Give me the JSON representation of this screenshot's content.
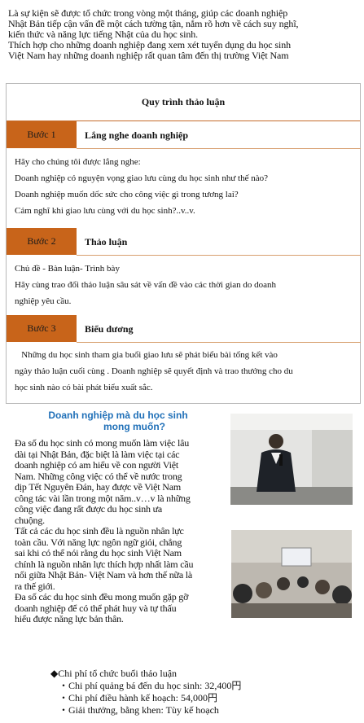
{
  "intro": {
    "lines": [
      "Là sự kiện sẽ được tổ chức trong vòng một tháng, giúp các doanh nghiệp",
      "Nhật Bản tiếp cận vấn đề một cách tường tận, nắm rõ hơn về cách suy nghĩ,",
      "kiến thức và năng lực tiếng Nhật của du học sinh.",
      "Thích hợp cho những doanh nghiệp đang xem xét tuyển dụng du học sinh",
      "Việt Nam hay những doanh nghiệp rất quan tâm đến thị trường Việt Nam"
    ]
  },
  "process": {
    "title": "Quy trình thảo luận",
    "steps": [
      {
        "label": "Bước 1",
        "title": "Lắng nghe doanh nghiệp",
        "lines": [
          "Hãy cho chúng tôi được lắng nghe:",
          "Doanh nghiệp có nguyện vọng giao lưu cùng du học sinh như thế nào?",
          "Doanh nghiệp muốn dốc sức cho công việc gì trong tương lai?",
          "Cảm nghĩ khi giao lưu cùng với du học sinh?..v..v."
        ]
      },
      {
        "label": "Bước 2",
        "title": "Thảo luận",
        "lines": [
          "Chủ đề - Bàn luận- Trình bày",
          "Hãy cùng trao đổi thảo luận sâu sát về vấn đề vào các thời gian do doanh",
          "nghiệp yêu cầu."
        ]
      },
      {
        "label": "Bước 3",
        "title": "Biểu dương",
        "lines": [
          "   Những du học sinh tham gia buổi giao lưu sẽ phát biểu bài tổng kết vào",
          "ngày thảo luận cuối cùng . Doanh nghiệp sẽ quyết định và trao thưởng cho du",
          "học sinh nào có bài phát biểu xuất sắc."
        ]
      }
    ]
  },
  "section2": {
    "heading_line1": "Doanh nghiệp mà du học sinh",
    "heading_line2": "mong muốn?",
    "lines": [
      "Đa số du học sinh có mong muốn làm việc lâu",
      "dài tại Nhật Bản, đặc biệt là làm việc tại các",
      "doanh nghiệp có am hiểu về con người Việt",
      "Nam. Những công việc có thể về nước trong",
      "dịp Tết Nguyên Đán, hay được về Việt Nam",
      "công tác vài lần trong một năm..v…v là những",
      "công việc đang rất được du học sinh ưa",
      "chuộng.",
      "Tất cả các du học sinh đều là nguồn nhân lực",
      "toàn cầu. Với năng lực ngôn ngữ giỏi, chẳng",
      "sai khi có thể nói rằng du học sinh Việt Nam",
      "chính là nguồn nhân lực thích hợp nhất làm cầu",
      "nối giữa Nhật Bản- Việt Nam và hơn thế nữa là",
      "ra thế giới.",
      "Đa số các du học sinh đều mong muốn gặp gỡ",
      "doanh nghiệp để có thể phát huy và tự thấu",
      "hiểu được năng lực bản thân."
    ]
  },
  "cost": {
    "heading": "◆Chi phí tổ chức buổi thảo luận",
    "items": [
      "・Chi phí quảng bá đến du học sinh: 32,400円",
      "・Chi phí điều hành kế hoạch: 54,000円",
      "・Giải thưởng, bằng khen: Tùy kế hoạch"
    ]
  }
}
